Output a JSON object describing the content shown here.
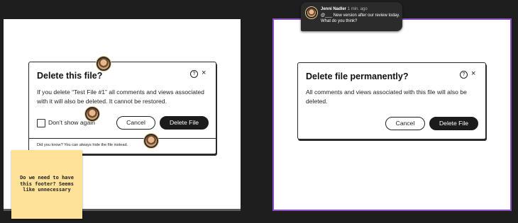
{
  "left_dialog": {
    "title": "Delete this file?",
    "help_icon": "?",
    "close_icon": "×",
    "body": "If you delete “Test File #1” all comments and views associated with it will also be deleted. It cannot be restored.",
    "checkbox_label": "Don’t show again",
    "cancel_label": "Cancel",
    "delete_label": "Delete File",
    "footer_text": "Did you know? You can always hide the file instead."
  },
  "right_dialog": {
    "title": "Delete file permanently?",
    "help_icon": "?",
    "close_icon": "×",
    "body": "All comments and views associated with this file will also be deleted.",
    "cancel_label": "Cancel",
    "delete_label": "Delete File"
  },
  "sticky_note": {
    "text": "Do we need to have this footer? Seems like unnecessary"
  },
  "comment": {
    "author": "Jenni Nadler",
    "time": "1 min. ago",
    "text": "@___ New version after our review today. What do you think?"
  },
  "colors": {
    "canvas": "#1e1e1e",
    "selected_frame_border": "#8b4ec4",
    "sticky": "#ffe29a",
    "primary_button": "#1b1b1b"
  },
  "icons": [
    "help-circle-icon",
    "close-icon",
    "avatar"
  ]
}
